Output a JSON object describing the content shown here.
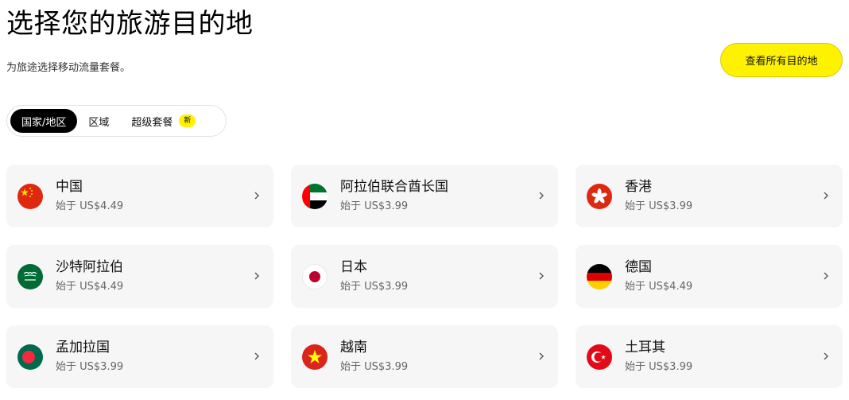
{
  "header": {
    "title": "选择您的旅游目的地",
    "subtitle": "为旅途选择移动流量套餐。",
    "cta_label": "查看所有目的地"
  },
  "tabs": [
    {
      "label": "国家/地区",
      "active": true
    },
    {
      "label": "区域",
      "active": false
    },
    {
      "label": "超级套餐",
      "active": false,
      "badge": "新"
    }
  ],
  "destinations": [
    {
      "name": "中国",
      "price": "始于 US$4.49",
      "flag": "china-flag-icon"
    },
    {
      "name": "阿拉伯联合酋长国",
      "price": "始于 US$3.99",
      "flag": "uae-flag-icon"
    },
    {
      "name": "香港",
      "price": "始于 US$3.99",
      "flag": "hongkong-flag-icon"
    },
    {
      "name": "沙特阿拉伯",
      "price": "始于 US$4.49",
      "flag": "saudi-flag-icon"
    },
    {
      "name": "日本",
      "price": "始于 US$3.99",
      "flag": "japan-flag-icon"
    },
    {
      "name": "德国",
      "price": "始于 US$4.49",
      "flag": "germany-flag-icon"
    },
    {
      "name": "孟加拉国",
      "price": "始于 US$3.99",
      "flag": "bangladesh-flag-icon"
    },
    {
      "name": "越南",
      "price": "始于 US$3.99",
      "flag": "vietnam-flag-icon"
    },
    {
      "name": "土耳其",
      "price": "始于 US$3.99",
      "flag": "turkey-flag-icon"
    }
  ],
  "colors": {
    "accent": "#fff200",
    "card_bg": "#f6f6f6",
    "active_tab_bg": "#000000"
  }
}
